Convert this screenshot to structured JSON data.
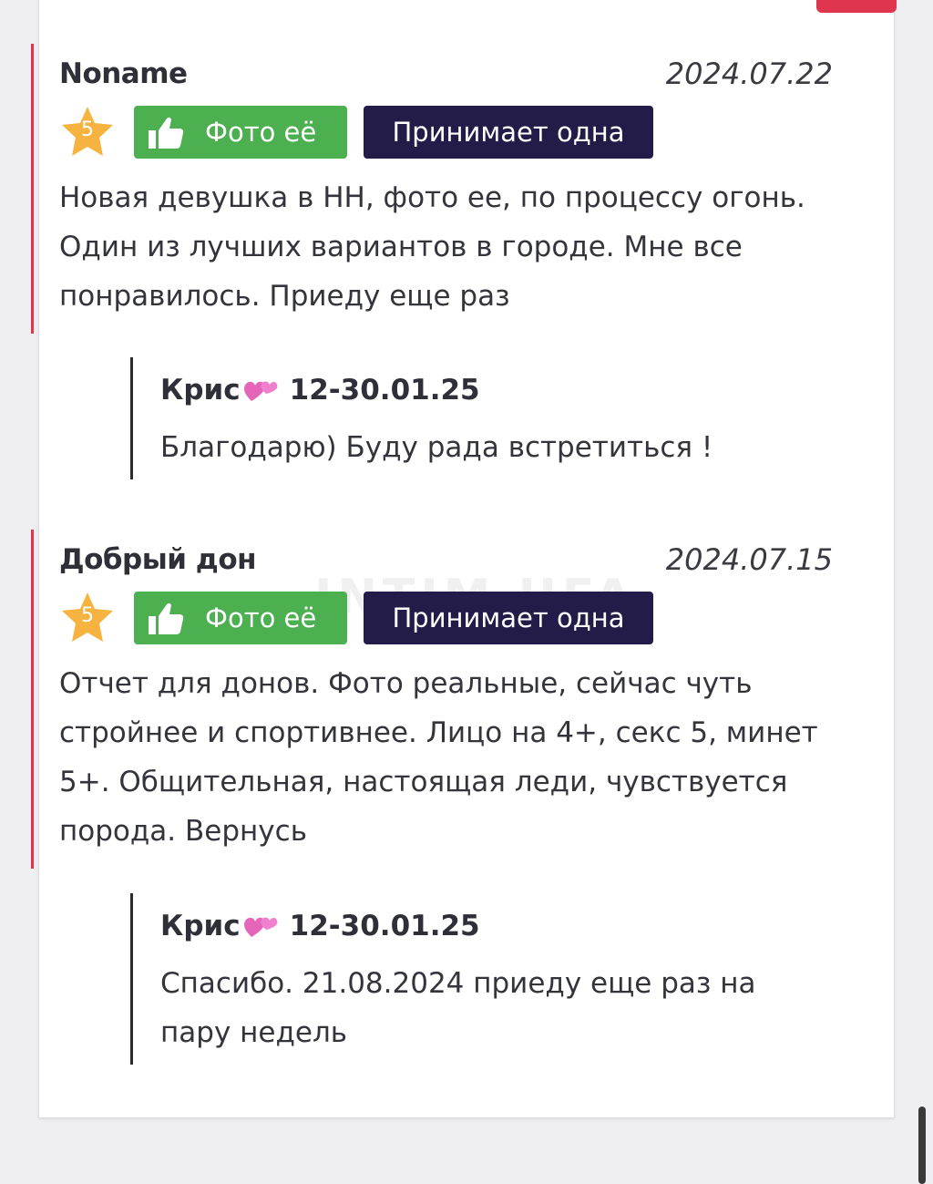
{
  "reviews": [
    {
      "author": "Noname",
      "date": "2024.07.22",
      "rating": "5",
      "badge_photo": "Фото её",
      "badge_accepts": "Принимает одна",
      "text": "Новая девушка в НН, фото ее, по процессу огонь. Один из лучших вариантов в городе. Мне все понравилось. Приеду еще раз",
      "reply": {
        "author": "Крис",
        "period": "12-30.01.25",
        "text": "Благодарю) Буду рада встретиться !"
      }
    },
    {
      "author": "Добрый дон",
      "date": "2024.07.15",
      "rating": "5",
      "badge_photo": "Фото её",
      "badge_accepts": "Принимает одна",
      "text": "Отчет для донов. Фото реальные, сейчас чуть стройнее и спортивнее. Лицо на 4+, секс 5, минет 5+. Общительная, настоящая леди, чувствуется порода. Вернусь",
      "reply": {
        "author": "Крис",
        "period": "12-30.01.25",
        "text": "Спасибо. 21.08.2024 приеду еще раз на пару недель"
      }
    }
  ],
  "watermark": "INTIM UFA",
  "icons": {
    "star": "star-icon",
    "thumb": "thumbs-up-icon",
    "heart": "two-hearts-icon"
  },
  "colors": {
    "accent": "#e0354f",
    "photo_badge": "#4caf50",
    "accepts_badge": "#241c48",
    "star": "#f6b33f"
  }
}
